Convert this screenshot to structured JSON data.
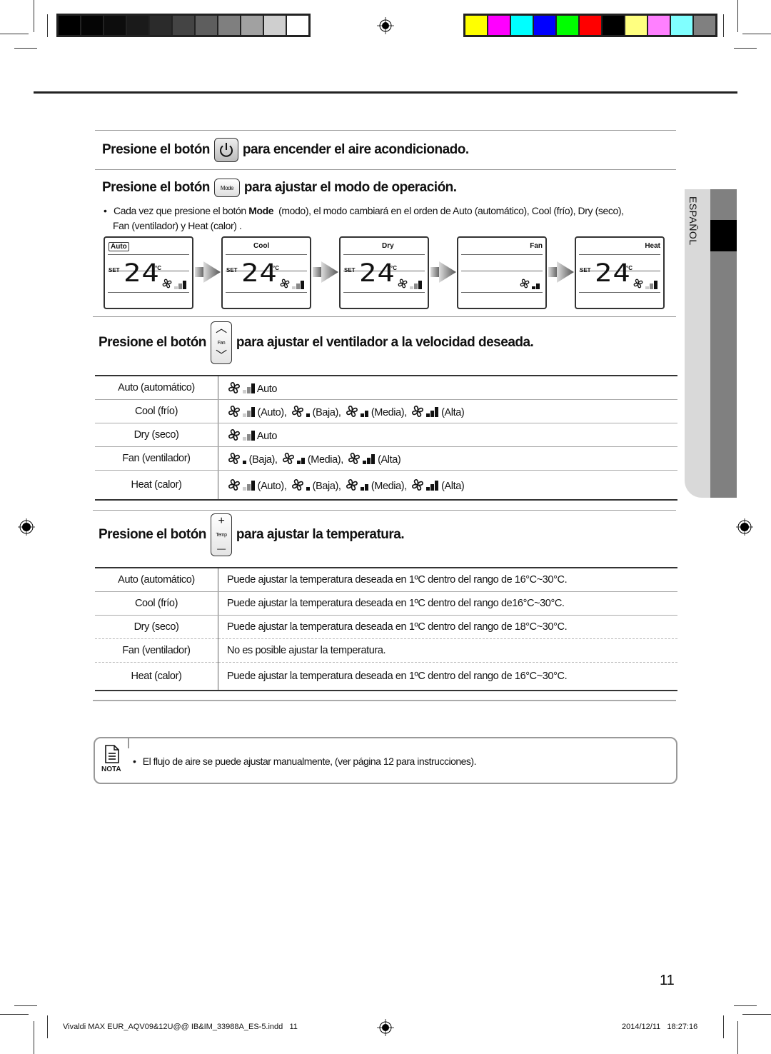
{
  "color_bars": {
    "grayscale": [
      "#000000",
      "#050505",
      "#0d0d0d",
      "#1a1a1a",
      "#2b2b2b",
      "#444444",
      "#5e5e5e",
      "#7f7f7f",
      "#a1a1a1",
      "#cfcfcf",
      "#ffffff"
    ],
    "process": [
      "#ffff00",
      "#ff00ff",
      "#00ffff",
      "#0000ff",
      "#00ff00",
      "#ff0000",
      "#000000",
      "#ffff80",
      "#ff80ff",
      "#80ffff",
      "#808080"
    ]
  },
  "side_tab": {
    "label": "ESPAÑOL"
  },
  "section_power": {
    "prefix": "Presione el botón",
    "suffix": "para encender el aire acondicionado.",
    "button_icon": "power-icon"
  },
  "section_mode": {
    "prefix": "Presione el botón",
    "button_label": "Mode",
    "suffix": "para ajustar el modo de operación.",
    "bullet": "•",
    "text_1": "Cada vez que presione el botón ",
    "text_bold": "Mode",
    "text_2": "  (modo), el modo cambiará en el orden de Auto (automático), Cool (frío), Dry (seco),",
    "text_3": "Fan (ventilador) y Heat (calor) .",
    "displays": [
      {
        "mode": "Auto",
        "set": "SET",
        "temp": "24",
        "unit": "°C",
        "show_temp": true,
        "boxed": true,
        "fan_level": "auto"
      },
      {
        "mode": "Cool",
        "set": "SET",
        "temp": "24",
        "unit": "°C",
        "show_temp": true,
        "boxed": false,
        "fan_level": "auto"
      },
      {
        "mode": "Dry",
        "set": "SET",
        "temp": "24",
        "unit": "°C",
        "show_temp": true,
        "boxed": false,
        "fan_level": "auto"
      },
      {
        "mode": "Fan",
        "set": "",
        "temp": "",
        "unit": "",
        "show_temp": false,
        "boxed": false,
        "fan_level": "medium"
      },
      {
        "mode": "Heat",
        "set": "SET",
        "temp": "24",
        "unit": "°C",
        "show_temp": true,
        "boxed": false,
        "fan_level": "auto"
      }
    ]
  },
  "section_fan": {
    "prefix": "Presione el botón",
    "button_label": "Fan",
    "suffix": "para ajustar el ventilador a la velocidad deseada.",
    "rows": [
      {
        "mode": "Auto (automático)",
        "options": [
          {
            "level": "auto",
            "label": "Auto"
          }
        ]
      },
      {
        "mode": "Cool (frío)",
        "options": [
          {
            "level": "auto",
            "label": "(Auto),"
          },
          {
            "level": "low",
            "label": "(Baja),"
          },
          {
            "level": "medium",
            "label": "(Media),"
          },
          {
            "level": "high",
            "label": "(Alta)"
          }
        ]
      },
      {
        "mode": "Dry (seco)",
        "options": [
          {
            "level": "auto",
            "label": "Auto"
          }
        ]
      },
      {
        "mode": "Fan (ventilador)",
        "options": [
          {
            "level": "low",
            "label": "(Baja),"
          },
          {
            "level": "medium",
            "label": "(Media),"
          },
          {
            "level": "high",
            "label": "(Alta)"
          }
        ]
      },
      {
        "mode": "Heat (calor)",
        "options": [
          {
            "level": "auto",
            "label": "(Auto),"
          },
          {
            "level": "low",
            "label": "(Baja),"
          },
          {
            "level": "medium",
            "label": "(Media),"
          },
          {
            "level": "high",
            "label": "(Alta)"
          }
        ]
      }
    ]
  },
  "section_temp": {
    "prefix": "Presione el botón",
    "button_label": "Temp",
    "plus": "+",
    "minus": "—",
    "suffix": "para ajustar la temperatura.",
    "rows": [
      {
        "mode": "Auto (automático)",
        "desc": "Puede ajustar la temperatura deseada en 1ºC dentro del rango de 16°C~30°C."
      },
      {
        "mode": "Cool (frío)",
        "desc": "Puede ajustar la temperatura deseada en 1ºC dentro del rango de16°C~30°C."
      },
      {
        "mode": "Dry (seco)",
        "desc": "Puede ajustar la temperatura deseada en 1ºC dentro del rango de 18°C~30°C."
      },
      {
        "mode": "Fan (ventilador)",
        "desc": "No es posible ajustar la temperatura."
      },
      {
        "mode": "Heat (calor)",
        "desc": "Puede ajustar la temperatura deseada en 1ºC dentro del rango de 16°C~30°C."
      }
    ]
  },
  "note": {
    "label": "NOTA",
    "bullet": "•",
    "text": "El flujo de aire se puede ajustar manualmente, (ver página 12 para instrucciones)."
  },
  "page_number": "11",
  "footer": {
    "file": "Vivaldi MAX EUR_AQV09&12U@@ IB&IM_33988A_ES-5.indd   11",
    "timestamp": "2014/12/11   18:27:16"
  }
}
